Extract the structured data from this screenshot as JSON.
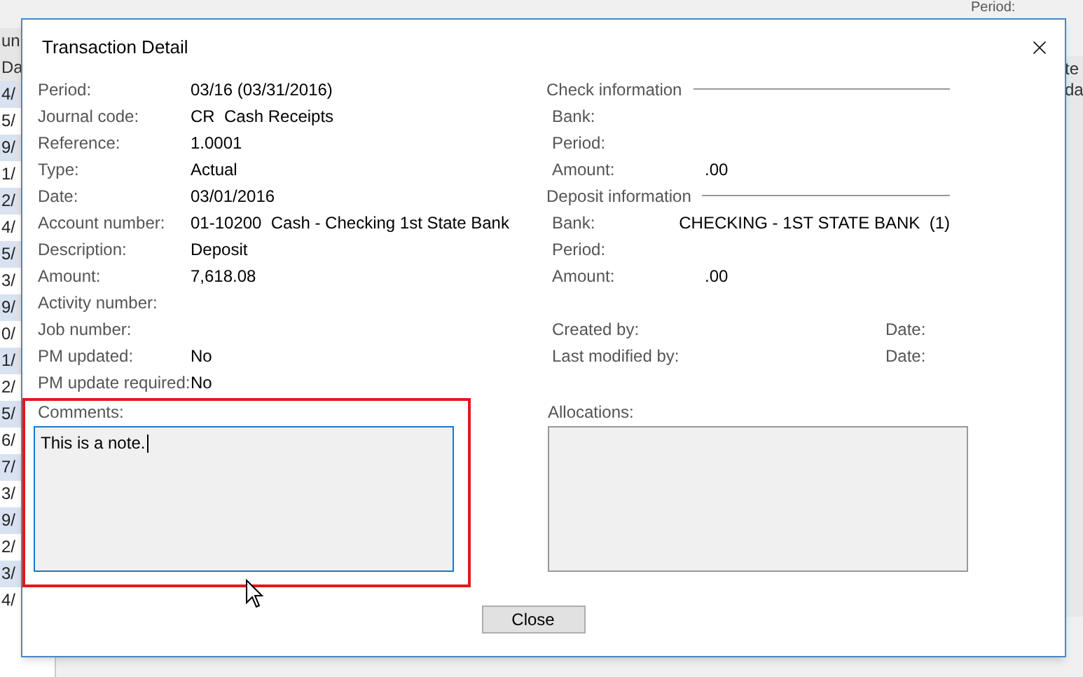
{
  "background": {
    "header_fragments": [
      "un",
      "Da"
    ],
    "row_fragments": [
      "4/",
      "5/",
      "9/",
      "1/",
      "2/",
      "4/",
      "5/",
      "3/",
      "9/",
      "0/",
      "1/",
      "2/",
      "5/",
      "6/",
      "7/",
      "3/",
      "9/",
      "2/",
      "3/",
      "4/"
    ],
    "right_fragments": [
      "Period:",
      "te",
      "da"
    ]
  },
  "window": {
    "title": "Transaction Detail"
  },
  "fields": [
    {
      "label": "Period:",
      "value": "03/16 (03/31/2016)"
    },
    {
      "label": "Journal code:",
      "value": "CR  Cash Receipts"
    },
    {
      "label": "Reference:",
      "value": "1.0001"
    },
    {
      "label": "Type:",
      "value": "Actual"
    },
    {
      "label": "Date:",
      "value": "03/01/2016"
    },
    {
      "label": "Account number:",
      "value": "01-10200  Cash - Checking 1st State Bank"
    },
    {
      "label": "Description:",
      "value": "Deposit"
    },
    {
      "label": "Amount:",
      "value": "7,618.08"
    },
    {
      "label": "Activity number:"
    },
    {
      "label": "Job number:"
    },
    {
      "label": "PM updated:",
      "value": "No"
    },
    {
      "label": "PM update required:",
      "value": "No"
    }
  ],
  "check_information": {
    "heading": "Check information",
    "fields": [
      {
        "label": "Bank:"
      },
      {
        "label": "Period:"
      },
      {
        "label": "Amount:",
        "value": ".00"
      }
    ]
  },
  "deposit_information": {
    "heading": "Deposit information",
    "fields": [
      {
        "label": "Bank:",
        "value": "CHECKING - 1ST STATE BANK  (1)"
      },
      {
        "label": "Period:"
      },
      {
        "label": "Amount:",
        "value": ".00"
      }
    ]
  },
  "audit": [
    {
      "label": "Created by:",
      "date_label": "Date:"
    },
    {
      "label": "Last modified by:",
      "date_label": "Date:"
    }
  ],
  "comments": {
    "label": "Comments:",
    "value": "This is a note.",
    "focused": true,
    "highlighted": true
  },
  "allocations": {
    "label": "Allocations:"
  },
  "close_button": "Close"
}
